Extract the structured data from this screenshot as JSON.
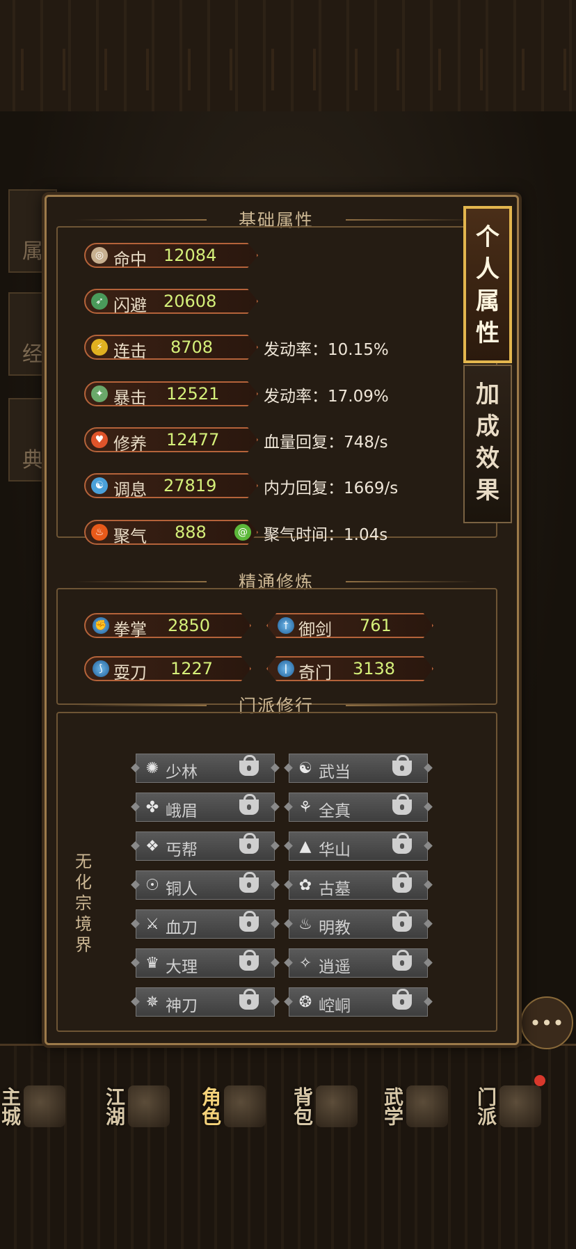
{
  "side_tabs_bg": [
    "属",
    "经",
    "典"
  ],
  "nav": [
    {
      "label": "主城"
    },
    {
      "label": "江湖"
    },
    {
      "label": "角色",
      "active": true
    },
    {
      "label": "背包"
    },
    {
      "label": "武学"
    },
    {
      "label": "门派"
    }
  ],
  "tabs": {
    "personal": "个人属性",
    "bonus": "加成效果"
  },
  "basic": {
    "title": "基础属性",
    "stats": [
      {
        "name": "命中",
        "value": "12084",
        "extra": "",
        "icon_color": "#c8b090",
        "icon": "accuracy-icon"
      },
      {
        "name": "闪避",
        "value": "20608",
        "extra": "",
        "icon_color": "#4a9a5a",
        "icon": "dodge-icon"
      },
      {
        "name": "连击",
        "value": "8708",
        "extra": "发动率：10.15%",
        "icon_color": "#e0b020",
        "icon": "combo-icon"
      },
      {
        "name": "暴击",
        "value": "12521",
        "extra": "发动率：17.09%",
        "icon_color": "#6aa86a",
        "icon": "crit-icon"
      },
      {
        "name": "修养",
        "value": "12477",
        "extra": "血量回复：748/s",
        "icon_color": "#e0542a",
        "icon": "heart-icon"
      },
      {
        "name": "调息",
        "value": "27819",
        "extra": "内力回复：1669/s",
        "icon_color": "#4aa0d8",
        "icon": "breath-icon"
      },
      {
        "name": "聚气",
        "value": "888",
        "extra": "聚气时间：1.04s",
        "icon_color": "#e85a1a",
        "icon": "flame-icon"
      }
    ]
  },
  "mastery": {
    "title": "精通修炼",
    "items": [
      {
        "name": "拳掌",
        "value": "2850",
        "icon": "fist-icon"
      },
      {
        "name": "御剑",
        "value": "761",
        "icon": "sword-icon"
      },
      {
        "name": "耍刀",
        "value": "1227",
        "icon": "blade-icon"
      },
      {
        "name": "奇门",
        "value": "3138",
        "icon": "odd-weapon-icon"
      }
    ]
  },
  "sects": {
    "title": "门派修行",
    "realm": "无化宗境界",
    "items": [
      "少林",
      "武当",
      "峨眉",
      "全真",
      "丐帮",
      "华山",
      "铜人",
      "古墓",
      "血刀",
      "明教",
      "大理",
      "逍遥",
      "神刀",
      "崆峒"
    ]
  }
}
